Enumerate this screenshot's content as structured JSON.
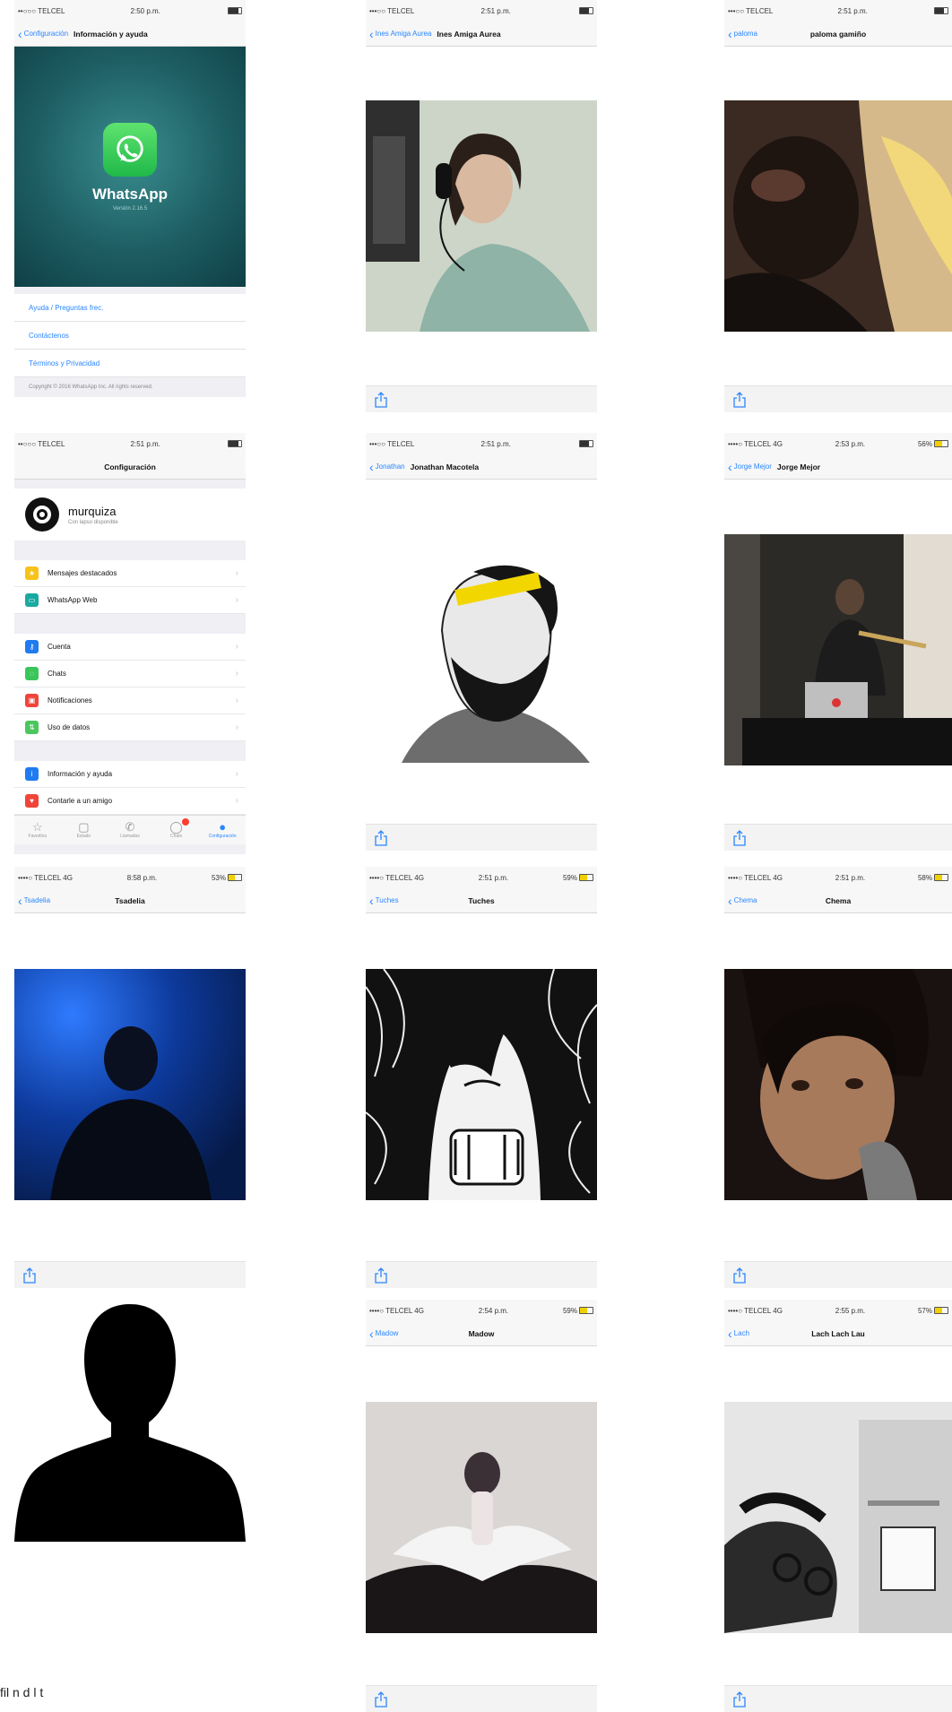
{
  "colors": {
    "ios_blue": "#2a86ff",
    "whatsapp_green": "#25d366",
    "battery_yellow": "#f0d000"
  },
  "cells": {
    "info": {
      "status": {
        "carrier": "••○○○ TELCEL",
        "time": "2:50 p.m.",
        "battery": ""
      },
      "nav": {
        "back": "Configuración",
        "title": "Información y ayuda"
      },
      "app_name": "WhatsApp",
      "version": "Versión 2.16.5",
      "links": [
        "Ayuda / Preguntas frec.",
        "Contáctenos",
        "Términos y Privacidad"
      ],
      "copyright": "Copyright © 2016 WhatsApp Inc. All rights reserved."
    },
    "ines": {
      "status": {
        "carrier": "•••○○ TELCEL",
        "time": "2:51 p.m."
      },
      "nav": {
        "back": "Ines Amiga Aurea",
        "title": "Ines Amiga Aurea"
      }
    },
    "paloma": {
      "status": {
        "carrier": "•••○○ TELCEL",
        "time": "2:51 p.m."
      },
      "nav": {
        "back": "paloma",
        "title": "paloma gamiño"
      }
    },
    "settings": {
      "status": {
        "carrier": "••○○○ TELCEL",
        "time": "2:51 p.m."
      },
      "nav": {
        "title": "Configuración"
      },
      "profile": {
        "name": "murquiza",
        "status": "Con lapso disponible"
      },
      "group1": [
        "Mensajes destacados",
        "WhatsApp Web"
      ],
      "group2": [
        "Cuenta",
        "Chats",
        "Notificaciones",
        "Uso de datos"
      ],
      "group3": [
        "Información y ayuda",
        "Contarle a un amigo"
      ],
      "tabs": [
        "Favoritos",
        "Estado",
        "Llamadas",
        "Chats",
        "Configuración"
      ]
    },
    "jonathan": {
      "status": {
        "carrier": "•••○○ TELCEL",
        "time": "2:51 p.m."
      },
      "nav": {
        "back": "Jonathan",
        "title": "Jonathan Macotela"
      }
    },
    "jorge": {
      "status": {
        "carrier": "••••○ TELCEL  4G",
        "time": "2:53 p.m.",
        "battery": "56%"
      },
      "nav": {
        "back": "Jorge Mejor",
        "title": "Jorge Mejor"
      }
    },
    "tsadelia": {
      "status": {
        "carrier": "••••○ TELCEL  4G",
        "time": "8:58 p.m.",
        "battery": "53%"
      },
      "nav": {
        "back": "Tsadelia",
        "title": "Tsadelia"
      }
    },
    "tuches": {
      "status": {
        "carrier": "••••○ TELCEL  4G",
        "time": "2:51 p.m.",
        "battery": "59%"
      },
      "nav": {
        "back": "Tuches",
        "title": "Tuches"
      }
    },
    "chema": {
      "status": {
        "carrier": "••••○ TELCEL  4G",
        "time": "2:51 p.m.",
        "battery": "58%"
      },
      "nav": {
        "back": "Chema",
        "title": "Chema"
      }
    },
    "madow": {
      "status": {
        "carrier": "••••○ TELCEL  4G",
        "time": "2:54 p.m.",
        "battery": "59%"
      },
      "nav": {
        "back": "Madow",
        "title": "Madow"
      }
    },
    "lach": {
      "status": {
        "carrier": "••••○ TELCEL  4G",
        "time": "2:55 p.m.",
        "battery": "57%"
      },
      "nav": {
        "back": "Lach",
        "title": "Lach Lach Lau"
      }
    }
  },
  "caption": "fil   n   d     l   t"
}
